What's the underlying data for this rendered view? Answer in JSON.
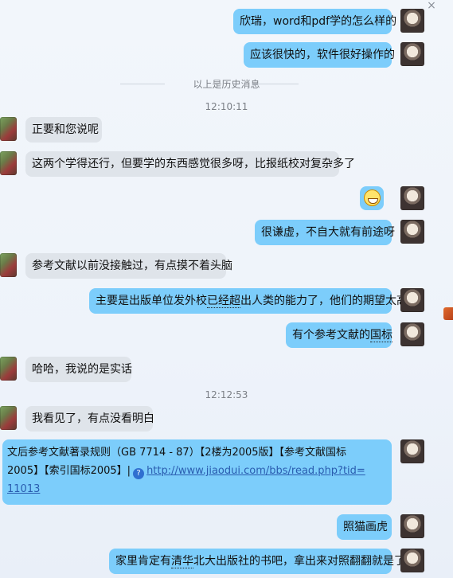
{
  "window": {
    "close_glyph": "×"
  },
  "history_divider": "以上是历史消息",
  "timestamps": [
    "12:10:11",
    "12:12:53"
  ],
  "messages": [
    {
      "side": "mine",
      "text": "欣瑞，word和pdf学的怎么样的"
    },
    {
      "side": "mine",
      "text": "应该很快的，软件很好操作的"
    },
    {
      "side": "theirs",
      "text": "正要和您说呢"
    },
    {
      "side": "theirs",
      "text": "这两个学得还行，但要学的东西感觉很多呀，比报纸校对复杂多了"
    },
    {
      "side": "mine",
      "emoji": "grinning-face-icon"
    },
    {
      "side": "mine",
      "text": "很谦虚，不自大就有前途呀"
    },
    {
      "side": "theirs",
      "text": "参考文献以前没接触过，有点摸不着头脑"
    },
    {
      "side": "mine",
      "text_before": "主要是出版单位发外校",
      "dotted": "已经超",
      "text_after": "出人类的能力了，他们的期望太高"
    },
    {
      "side": "mine",
      "text_before": "有个参考文献的",
      "dotted": "国标",
      "text_after": ""
    },
    {
      "side": "theirs",
      "text": "哈哈，我说的是实话"
    },
    {
      "side": "theirs",
      "text": "我看见了，有点没看明白"
    },
    {
      "side": "mine",
      "line1": "文后参考文献著录规则（GB 7714 - 87）【2楼为2005版】【参考文献国标",
      "line2_prefix": "2005】【索引国标2005】|",
      "link_part1": "http://www.jiaodui.com/bbs/read.php?tid=",
      "link_part2": "11013"
    },
    {
      "side": "mine",
      "text": "照猫画虎"
    },
    {
      "side": "mine",
      "text_before": "家里肯定有",
      "dotted": "清华",
      "text_after": "北大出版社的书吧，拿出来对照翻翻就是了"
    }
  ]
}
